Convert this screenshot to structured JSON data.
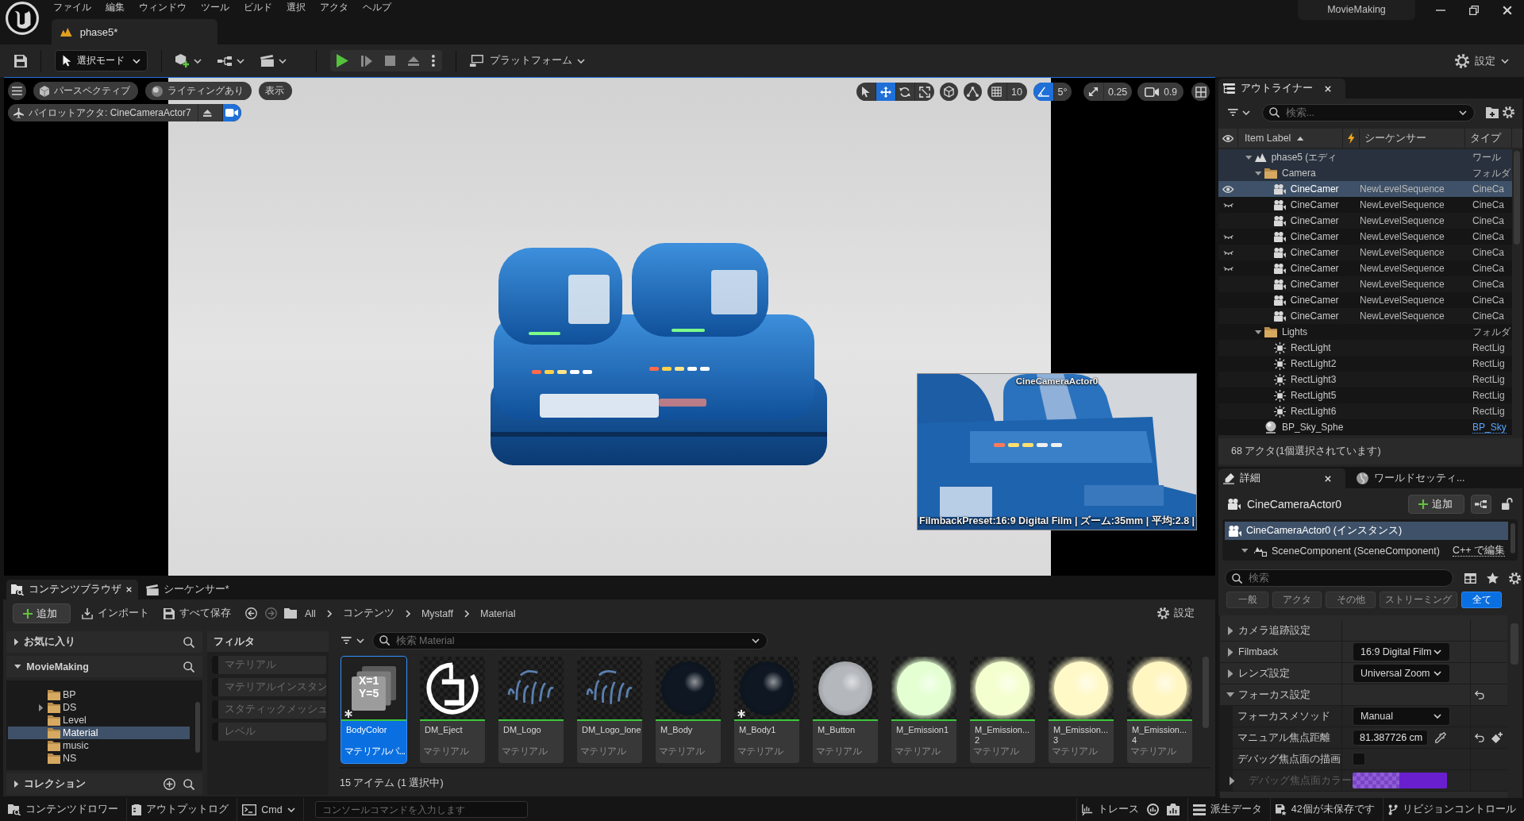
{
  "title_bar": {
    "menu": [
      "ファイル",
      "編集",
      "ウィンドウ",
      "ツール",
      "ビルド",
      "選択",
      "アクタ",
      "ヘルプ"
    ],
    "level_tab": "phase5*",
    "project": "MovieMaking"
  },
  "toolbar": {
    "mode": "選択モード",
    "platform": "プラットフォーム",
    "settings": "設定"
  },
  "viewport": {
    "view_buttons": [
      {
        "kind": "perspective",
        "label": "パースペクティブ"
      },
      {
        "kind": "lighting",
        "label": "ライティングあり"
      },
      {
        "kind": "show",
        "label": "表示"
      }
    ],
    "pilot": "パイロットアクタ: CineCameraActor7",
    "transform_tools": [
      {
        "kind": "select",
        "selected": false
      },
      {
        "kind": "translate",
        "selected": true
      },
      {
        "kind": "rotate",
        "selected": false
      },
      {
        "kind": "scale",
        "selected": false
      }
    ],
    "snaps": [
      {
        "kind": "grid",
        "value": "10",
        "on": false
      },
      {
        "kind": "angle",
        "value": "5°",
        "on": true
      },
      {
        "kind": "scale",
        "value": "0.25",
        "on": false
      }
    ],
    "camera_speed": "0.9",
    "camera_preview": {
      "title": "CineCameraActor0",
      "info": "FilmbackPreset:16:9 Digital Film | ズーム:35mm | 平均:2.8 |"
    }
  },
  "outliner": {
    "tab": "アウトライナー",
    "search_placeholder": "検索...",
    "columns": [
      {
        "kind": "visibility"
      },
      {
        "kind": "label",
        "label": "Item Label",
        "sort_ascending": true
      },
      {
        "kind": "sequencer_flag"
      },
      {
        "kind": "text",
        "label": "シーケンサー"
      },
      {
        "kind": "text",
        "label": "タイプ"
      }
    ],
    "rows": [
      {
        "kind": "world",
        "label": "phase5 (エディ",
        "type": "ワール",
        "type_link": false,
        "expanded": true,
        "selected": false,
        "hidden": false,
        "children": [
          {
            "kind": "folder",
            "label": "Camera",
            "type": "フォルダ",
            "type_link": false,
            "expanded": true,
            "selected": false,
            "hidden": false,
            "children": [
              {
                "kind": "camera",
                "label": "CineCamer",
                "sequencer": "NewLevelSequence",
                "type": "CineCa",
                "type_link": false,
                "selected": true,
                "hidden": false
              },
              {
                "kind": "camera",
                "label": "CineCamer",
                "sequencer": "NewLevelSequence",
                "type": "CineCa",
                "type_link": false,
                "selected": false,
                "hidden": true
              },
              {
                "kind": "camera",
                "label": "CineCamer",
                "sequencer": "NewLevelSequence",
                "type": "CineCa",
                "type_link": false,
                "selected": false,
                "hidden": false
              },
              {
                "kind": "camera",
                "label": "CineCamer",
                "sequencer": "NewLevelSequence",
                "type": "CineCa",
                "type_link": false,
                "selected": false,
                "hidden": true
              },
              {
                "kind": "camera",
                "label": "CineCamer",
                "sequencer": "NewLevelSequence",
                "type": "CineCa",
                "type_link": false,
                "selected": false,
                "hidden": true
              },
              {
                "kind": "camera",
                "label": "CineCamer",
                "sequencer": "NewLevelSequence",
                "type": "CineCa",
                "type_link": false,
                "selected": false,
                "hidden": true
              },
              {
                "kind": "camera",
                "label": "CineCamer",
                "sequencer": "NewLevelSequence",
                "type": "CineCa",
                "type_link": false,
                "selected": false,
                "hidden": false
              },
              {
                "kind": "camera",
                "label": "CineCamer",
                "sequencer": "NewLevelSequence",
                "type": "CineCa",
                "type_link": false,
                "selected": false,
                "hidden": false
              },
              {
                "kind": "camera",
                "label": "CineCamer",
                "sequencer": "NewLevelSequence",
                "type": "CineCa",
                "type_link": false,
                "selected": false,
                "hidden": false
              }
            ]
          },
          {
            "kind": "folder",
            "label": "Lights",
            "type": "フォルダ",
            "type_link": false,
            "expanded": true,
            "selected": false,
            "hidden": false,
            "children": [
              {
                "kind": "light",
                "label": "RectLight",
                "type": "RectLig",
                "type_link": false,
                "selected": false,
                "hidden": false
              },
              {
                "kind": "light",
                "label": "RectLight2",
                "type": "RectLig",
                "type_link": false,
                "selected": false,
                "hidden": false
              },
              {
                "kind": "light",
                "label": "RectLight3",
                "type": "RectLig",
                "type_link": false,
                "selected": false,
                "hidden": false
              },
              {
                "kind": "light",
                "label": "RectLight5",
                "type": "RectLig",
                "type_link": false,
                "selected": false,
                "hidden": false
              },
              {
                "kind": "light",
                "label": "RectLight6",
                "type": "RectLig",
                "type_link": false,
                "selected": false,
                "hidden": false
              }
            ]
          },
          {
            "kind": "sky",
            "label": "BP_Sky_Sphe",
            "type": "BP_Sky",
            "type_link": true,
            "selected": false,
            "hidden": false
          }
        ]
      }
    ],
    "footer": "68 アクタ(1個選択されています)"
  },
  "details": {
    "tabs": [
      {
        "kind": "details",
        "label": "詳細",
        "selected": true
      },
      {
        "kind": "world_settings",
        "label": "ワールドセッティ...",
        "selected": false
      }
    ],
    "actor": "CineCameraActor0",
    "add_button": "追加",
    "components": [
      {
        "kind": "actor",
        "label": "CineCameraActor0 (インスタンス)",
        "selected": true
      },
      {
        "kind": "scene",
        "label": "SceneComponent (SceneComponent)",
        "selected": false,
        "expanded": true,
        "link": "C++ で編集"
      }
    ],
    "search_placeholder": "検索",
    "filters": [
      {
        "label": "一般",
        "selected": false
      },
      {
        "label": "アクタ",
        "selected": false
      },
      {
        "label": "その他",
        "selected": false
      },
      {
        "label": "ストリーミング",
        "selected": false
      },
      {
        "label": "全て",
        "selected": true
      }
    ],
    "properties": [
      {
        "label": "カメラ追跡設定",
        "expanded": false,
        "disabled": false,
        "reset": false
      },
      {
        "label": "Filmback",
        "expanded": false,
        "disabled": false,
        "reset": false,
        "value": {
          "kind": "dropdown",
          "text": "16:9 Digital Film"
        }
      },
      {
        "label": "レンズ設定",
        "expanded": false,
        "disabled": false,
        "reset": false,
        "value": {
          "kind": "dropdown",
          "text": "Universal Zoom"
        }
      },
      {
        "label": "フォーカス設定",
        "expanded": true,
        "disabled": false,
        "reset": true,
        "children": [
          {
            "label": "フォーカスメソッド",
            "disabled": false,
            "reset": false,
            "value": {
              "kind": "dropdown",
              "text": "Manual"
            }
          },
          {
            "label": "マニュアル焦点距離",
            "disabled": false,
            "reset": true,
            "value": {
              "kind": "number",
              "text": "81.387726 cm"
            }
          },
          {
            "label": "デバッグ焦点面の描画",
            "disabled": false,
            "reset": false,
            "value": {
              "kind": "checkbox",
              "checked": false
            }
          },
          {
            "label": "デバッグ焦点面カラー",
            "expanded": false,
            "disabled": true,
            "reset": false,
            "value": {
              "kind": "color",
              "color": "#6a1fcf"
            }
          }
        ]
      }
    ]
  },
  "content_browser": {
    "tabs": [
      {
        "kind": "browser",
        "label": "コンテンツブラウザ",
        "selected": true
      },
      {
        "kind": "sequencer",
        "label": "シーケンサー*",
        "selected": false
      }
    ],
    "add_button": "追加",
    "import_button": "インポート",
    "save_all_button": "すべて保存",
    "path": [
      "All",
      "コンテンツ",
      "Mystaff",
      "Material"
    ],
    "settings": "設定",
    "sections": [
      {
        "kind": "favorites",
        "label": "お気に入り",
        "expanded": false
      },
      {
        "kind": "project",
        "label": "MovieMaking",
        "expanded": true,
        "folders": [
          {
            "label": "BP",
            "selected": false
          },
          {
            "label": "DS",
            "expanded": false,
            "selected": false
          },
          {
            "label": "Level",
            "selected": false
          },
          {
            "label": "Material",
            "selected": true
          },
          {
            "label": "music",
            "selected": false
          },
          {
            "label": "NS",
            "selected": false
          }
        ]
      },
      {
        "kind": "collections",
        "label": "コレクション",
        "expanded": false
      }
    ],
    "filters": {
      "title": "フィルタ",
      "items": [
        {
          "label": "マテリアル",
          "checked": false
        },
        {
          "label": "マテリアルインスタン",
          "checked": false
        },
        {
          "label": "スタティックメッシュ",
          "checked": false
        },
        {
          "label": "レベル",
          "checked": false
        }
      ]
    },
    "search_placeholder": "検索 Material",
    "assets": [
      {
        "name": "BodyColor",
        "type": "マテリアルパ...",
        "selected": true,
        "modified": true,
        "preview": {
          "kind": "parameters",
          "lines": [
            "X=1",
            "Y=5"
          ]
        }
      },
      {
        "name": "DM_Eject",
        "type": "マテリアル",
        "selected": false,
        "modified": false,
        "preview": {
          "kind": "ring"
        }
      },
      {
        "name": "DM_Logo",
        "type": "マテリアル",
        "selected": false,
        "modified": false,
        "preview": {
          "kind": "strokes"
        }
      },
      {
        "name": "DM_Logo_lone",
        "type": "マテリアル",
        "selected": false,
        "modified": false,
        "preview": {
          "kind": "strokes"
        }
      },
      {
        "name": "M_Body",
        "type": "マテリアル",
        "selected": false,
        "modified": false,
        "preview": {
          "kind": "sphere",
          "color": "#0e1722",
          "glow": false
        }
      },
      {
        "name": "M_Body1",
        "type": "マテリアル",
        "selected": false,
        "modified": true,
        "preview": {
          "kind": "sphere",
          "color": "#0e1722",
          "glow": false
        }
      },
      {
        "name": "M_Button",
        "type": "マテリアル",
        "selected": false,
        "modified": false,
        "preview": {
          "kind": "sphere",
          "color": "#b4b8bd",
          "glow": false
        }
      },
      {
        "name": "M_Emission1",
        "type": "マテリアル",
        "selected": false,
        "modified": false,
        "preview": {
          "kind": "sphere",
          "color": "#e4ffd2",
          "glow": true
        }
      },
      {
        "name": "M_Emission...\n2",
        "type": "マテリアル",
        "selected": false,
        "modified": false,
        "preview": {
          "kind": "sphere",
          "color": "#f4ffd0",
          "glow": true
        }
      },
      {
        "name": "M_Emission...\n3",
        "type": "マテリアル",
        "selected": false,
        "modified": false,
        "preview": {
          "kind": "sphere",
          "color": "#fff9c8",
          "glow": true
        }
      },
      {
        "name": "M_Emission...\n4",
        "type": "マテリアル",
        "selected": false,
        "modified": false,
        "preview": {
          "kind": "sphere",
          "color": "#fff6c2",
          "glow": true
        }
      }
    ],
    "footer": "15 アイテム (1 選択中)"
  },
  "status_bar": {
    "left": [
      {
        "kind": "drawer",
        "label": "コンテンツドロワー"
      },
      {
        "kind": "log",
        "label": "アウトプットログ"
      },
      {
        "kind": "cmd",
        "label": "Cmd"
      }
    ],
    "console_placeholder": "コンソールコマンドを入力します",
    "right": [
      {
        "kind": "trace",
        "label": "トレース"
      },
      {
        "kind": "derived",
        "label": "派生データ"
      },
      {
        "kind": "unsaved",
        "label": "42個が未保存です"
      },
      {
        "kind": "revision",
        "label": "リビジョンコントロール"
      }
    ]
  }
}
